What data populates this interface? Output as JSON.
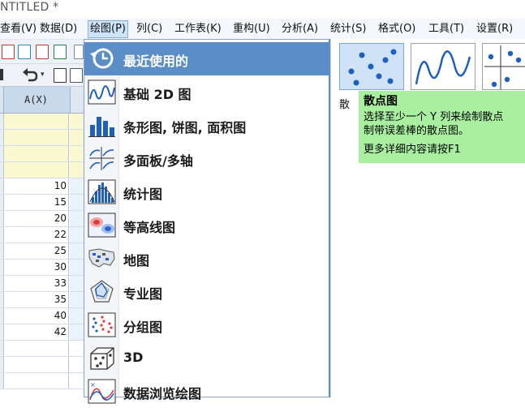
{
  "window": {
    "title": "NTITLED *"
  },
  "menubar": {
    "items": [
      {
        "label": "查看(V)"
      },
      {
        "label": "数据(D)"
      },
      {
        "label": "绘图(P)"
      },
      {
        "label": "列(C)"
      },
      {
        "label": "工作表(K)"
      },
      {
        "label": "重构(U)"
      },
      {
        "label": "分析(A)"
      },
      {
        "label": "统计(S)"
      },
      {
        "label": "格式(O)"
      },
      {
        "label": "工具(T)"
      },
      {
        "label": "设置(R)"
      }
    ]
  },
  "worksheet": {
    "column_header": "A(X)",
    "values": [
      "10",
      "15",
      "20",
      "22",
      "25",
      "30",
      "33",
      "35",
      "40",
      "42"
    ]
  },
  "plot_menu": {
    "items": [
      {
        "label": "最近使用的",
        "icon": "recent-clock-icon",
        "highlighted": true
      },
      {
        "label": "基础 2D 图",
        "icon": "line-plot-icon"
      },
      {
        "label": "条形图, 饼图, 面积图",
        "icon": "bar-chart-icon"
      },
      {
        "label": "多面板/多轴",
        "icon": "multi-panel-icon"
      },
      {
        "label": "统计图",
        "icon": "histogram-icon"
      },
      {
        "label": "等高线图",
        "icon": "contour-icon"
      },
      {
        "label": "地图",
        "icon": "map-icon"
      },
      {
        "label": "专业图",
        "icon": "radar-icon"
      },
      {
        "label": "分组图",
        "icon": "grouped-plot-icon"
      },
      {
        "label": "3D",
        "icon": "3d-cube-icon"
      },
      {
        "label": "数据浏览绘图",
        "icon": "data-explore-icon"
      }
    ]
  },
  "gallery": {
    "caption": "散",
    "thumbnails": [
      "scatter-thumb-icon",
      "line-thumb-icon",
      "multi-scatter-thumb-icon"
    ]
  },
  "tooltip": {
    "title": "散点图",
    "line1": "选择至少一个 Y 列来绘制散点",
    "line2": "制带误差棒的散点图。",
    "help": "更多详细内容请按F1"
  },
  "colors": {
    "accent": "#5b8ec7",
    "tooltip_bg": "#a8f0a0",
    "meta_row": "#f9f8cf"
  }
}
